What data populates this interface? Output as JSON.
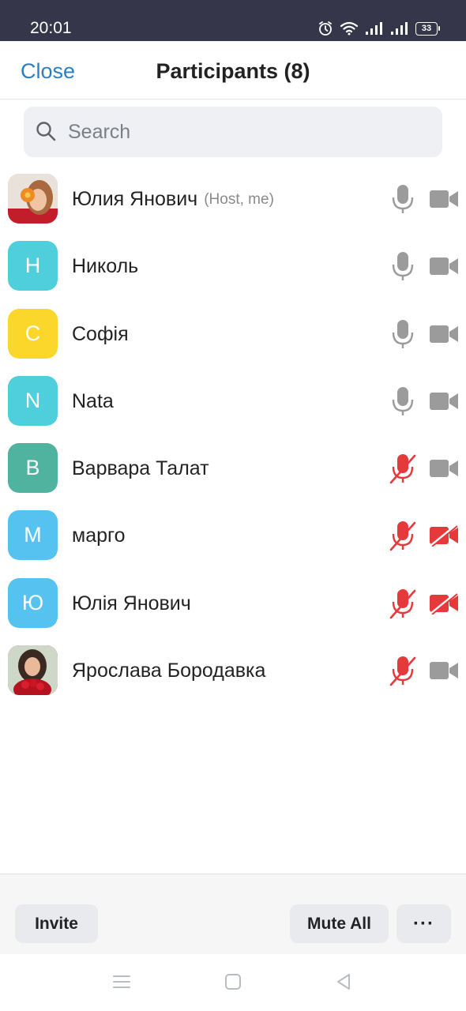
{
  "status_bar": {
    "time": "20:01",
    "battery": "33",
    "icons": [
      "alarm-icon",
      "wifi-icon",
      "signal-icon",
      "signal-icon",
      "battery-icon"
    ]
  },
  "header": {
    "close_label": "Close",
    "title": "Participants (8)"
  },
  "search": {
    "placeholder": "Search",
    "value": ""
  },
  "participants": [
    {
      "name": "Юлия Янович",
      "tag": "(Host, me)",
      "initial": "",
      "avatar_color": "#e8a87c",
      "mic": "on",
      "video": "on",
      "photo": true
    },
    {
      "name": "Николь",
      "tag": "",
      "initial": "Н",
      "avatar_color": "#4fcfdc",
      "mic": "on",
      "video": "on",
      "photo": false
    },
    {
      "name": "Софія",
      "tag": "",
      "initial": "С",
      "avatar_color": "#fbd72b",
      "mic": "on",
      "video": "on",
      "photo": false
    },
    {
      "name": "Nata",
      "tag": "",
      "initial": "N",
      "avatar_color": "#4fcfdc",
      "mic": "on",
      "video": "on",
      "photo": false
    },
    {
      "name": "Варвара Талат",
      "tag": "",
      "initial": "В",
      "avatar_color": "#4fb39f",
      "mic": "muted",
      "video": "on",
      "photo": false
    },
    {
      "name": "марго",
      "tag": "",
      "initial": "М",
      "avatar_color": "#56c2f0",
      "mic": "muted",
      "video": "off",
      "photo": false
    },
    {
      "name": "Юлія Янович",
      "tag": "",
      "initial": "Ю",
      "avatar_color": "#56c2f0",
      "mic": "muted",
      "video": "off",
      "photo": false
    },
    {
      "name": "Ярослава Бородавка",
      "tag": "",
      "initial": "",
      "avatar_color": "#7a4a3a",
      "mic": "muted",
      "video": "on",
      "photo": true
    }
  ],
  "bottom_bar": {
    "invite_label": "Invite",
    "mute_all_label": "Mute All",
    "more_label": "···"
  },
  "colors": {
    "accent": "#2a7fc4",
    "muted_red": "#e5393b",
    "icon_gray": "#9b9b9b"
  }
}
